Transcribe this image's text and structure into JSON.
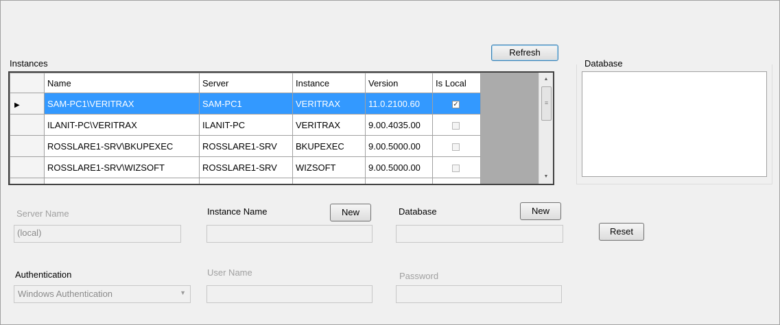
{
  "instances": {
    "group_label": "Instances",
    "refresh_label": "Refresh",
    "columns": [
      "Name",
      "Server",
      "Instance",
      "Version",
      "Is Local"
    ],
    "rows": [
      {
        "name": "SAM-PC1\\VERITRAX",
        "server": "SAM-PC1",
        "instance": "VERITRAX",
        "version": "11.0.2100.60",
        "is_local": true,
        "selected": true
      },
      {
        "name": "ILANIT-PC\\VERITRAX",
        "server": "ILANIT-PC",
        "instance": "VERITRAX",
        "version": "9.00.4035.00",
        "is_local": false
      },
      {
        "name": "ROSSLARE1-SRV\\BKUPEXEC",
        "server": "ROSSLARE1-SRV",
        "instance": "BKUPEXEC",
        "version": "9.00.5000.00",
        "is_local": false
      },
      {
        "name": "ROSSLARE1-SRV\\WIZSOFT",
        "server": "ROSSLARE1-SRV",
        "instance": "WIZSOFT",
        "version": "9.00.5000.00",
        "is_local": false
      }
    ],
    "row_selector_glyph": "▶",
    "check_glyph": "✓"
  },
  "database_group": {
    "label": "Database"
  },
  "form": {
    "server_name_label": "Server Name",
    "server_name_value": "(local)",
    "instance_name_label": "Instance Name",
    "instance_new_label": "New",
    "instance_name_value": "",
    "database_label": "Database",
    "database_new_label": "New",
    "database_value": "",
    "reset_label": "Reset",
    "authentication_label": "Authentication",
    "authentication_value": "Windows Authentication",
    "user_name_label": "User Name",
    "user_name_value": "",
    "password_label": "Password",
    "password_value": ""
  }
}
